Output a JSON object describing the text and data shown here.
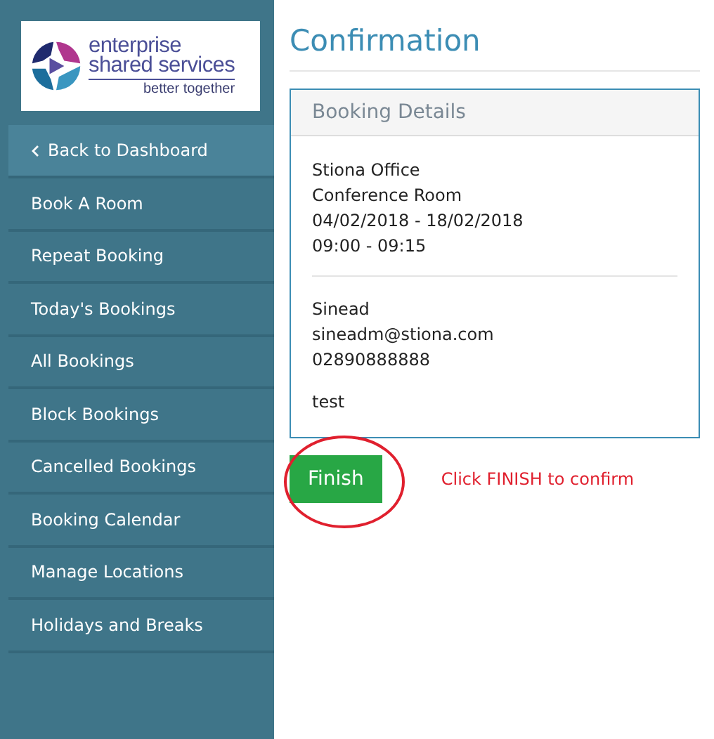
{
  "logo": {
    "name_lines": [
      "enterprise",
      "shared services"
    ],
    "tagline": "better together"
  },
  "sidebar": {
    "back": "Back to Dashboard",
    "items": [
      {
        "label": "Book A Room"
      },
      {
        "label": "Repeat Booking"
      },
      {
        "label": "Today's Bookings"
      },
      {
        "label": "All Bookings"
      },
      {
        "label": "Block Bookings"
      },
      {
        "label": "Cancelled Bookings"
      },
      {
        "label": "Booking Calendar"
      },
      {
        "label": "Manage Locations"
      },
      {
        "label": "Holidays and Breaks"
      }
    ]
  },
  "page_title": "Confirmation",
  "booking_details": {
    "title": "Booking Details",
    "groups": [
      [
        "Stiona Office",
        "Conference Room",
        "04/02/2018 - 18/02/2018",
        "09:00 - 09:15"
      ],
      [
        "Sinead",
        "sineadm@stiona.com",
        "02890888888"
      ],
      [
        "test"
      ]
    ]
  },
  "finish_button": "Finish",
  "annotation": {
    "text": "Click FINISH to confirm"
  }
}
